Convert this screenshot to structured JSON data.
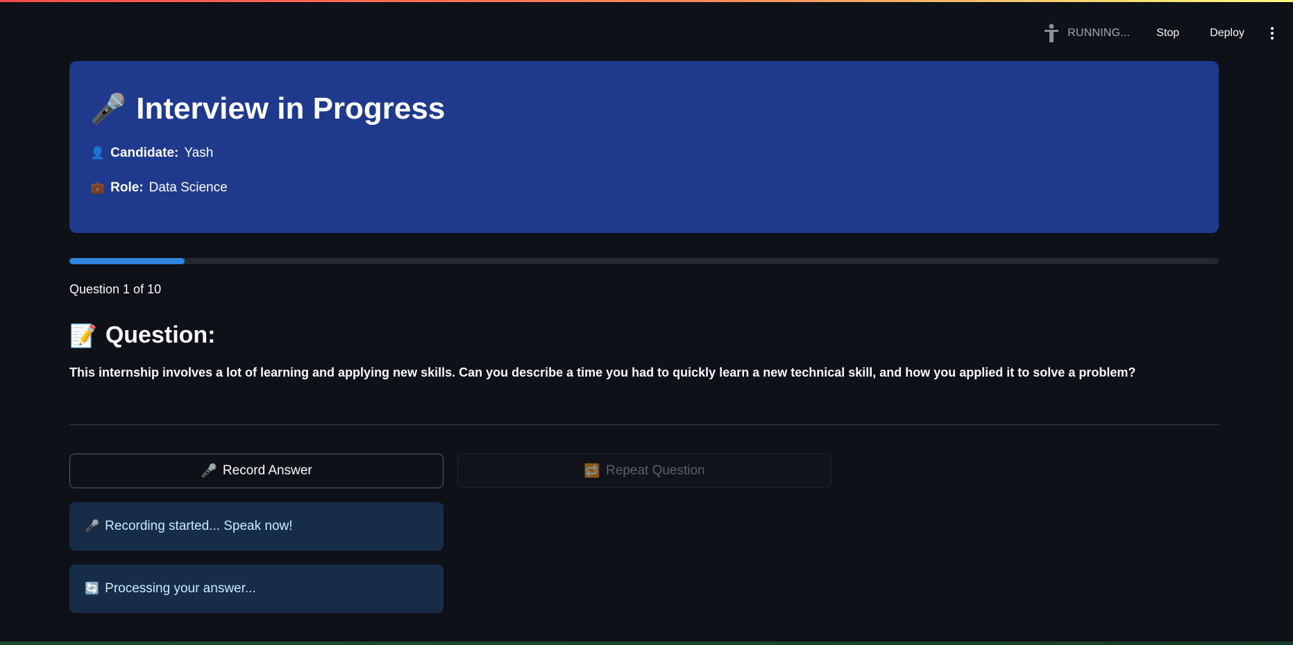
{
  "toolbar": {
    "status": "RUNNING...",
    "stop_label": "Stop",
    "deploy_label": "Deploy"
  },
  "header": {
    "icon": "🎤",
    "title": "Interview in Progress",
    "candidate_icon": "👤",
    "candidate_label": "Candidate:",
    "candidate_value": "Yash",
    "role_icon": "💼",
    "role_label": "Role:",
    "role_value": "Data Science"
  },
  "progress": {
    "current": 1,
    "total": 10,
    "fraction": 0.1,
    "text": "Question 1 of 10"
  },
  "question": {
    "icon": "📝",
    "heading": "Question:",
    "text": "This internship involves a lot of learning and applying new skills. Can you describe a time you had to quickly learn a new technical skill, and how you applied it to solve a problem?"
  },
  "buttons": {
    "record_icon": "🎤",
    "record_label": "Record Answer",
    "repeat_icon": "🔁",
    "repeat_label": "Repeat Question"
  },
  "alerts": [
    {
      "icon": "🎤",
      "text": "Recording started... Speak now!"
    },
    {
      "icon": "🔄",
      "text": "Processing your answer..."
    }
  ],
  "colors": {
    "background": "#0e1117",
    "header_card": "#1f3a8c",
    "progress_fill": "#2e86de",
    "progress_track": "#262730",
    "info_alert": "#172d47"
  }
}
